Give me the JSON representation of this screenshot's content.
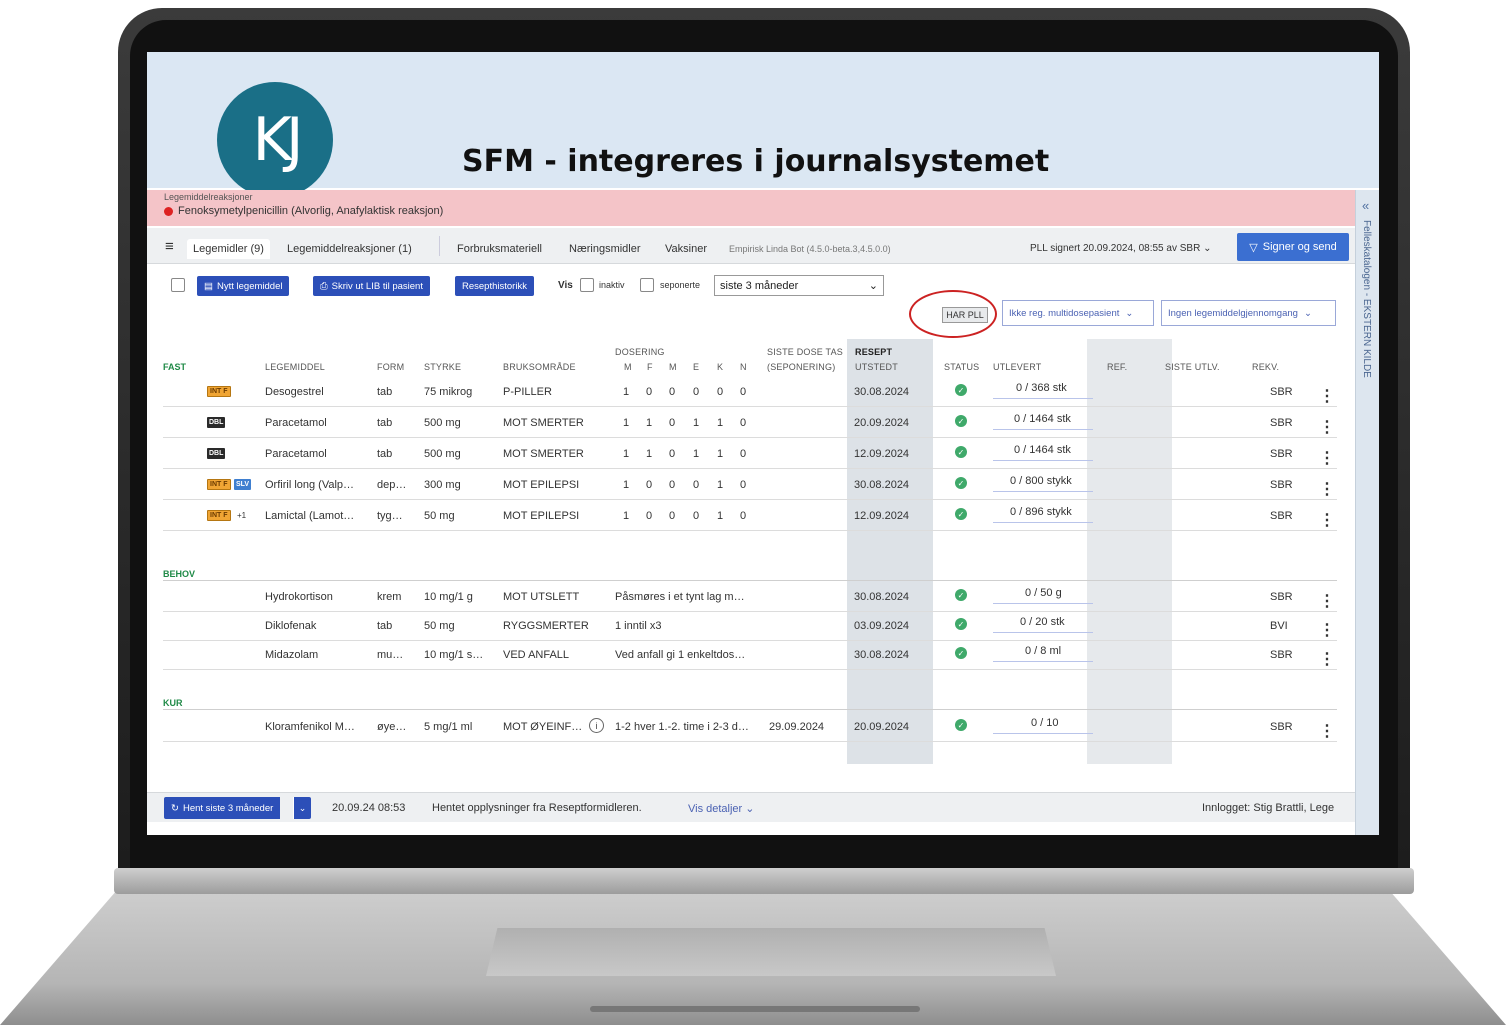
{
  "header": {
    "logo_text": "KJ",
    "title": "SFM - integreres i journalsystemet"
  },
  "allergy": {
    "label": "Legemiddelreaksjoner",
    "item": "Fenoksymetylpenicillin (Alvorlig, Anafylaktisk reaksjon)"
  },
  "side_rail": {
    "collapse": "«",
    "text": "Felleskatalogen - EKSTERN KILDE"
  },
  "tabs": {
    "menu": "≡",
    "items": [
      "Legemidler (9)",
      "Legemiddelreaksjoner (1)",
      "Forbruksmateriell",
      "Næringsmidler",
      "Vaksiner"
    ],
    "meta": "Empirisk Linda Bot (4.5.0-beta.3,4.5.0.0)",
    "pll_signed": "PLL signert 20.09.2024, 08:55 av SBR",
    "pll_chevron": "⌄",
    "sign_button": "Signer og send"
  },
  "toolbar": {
    "new_med": "Nytt legemiddel",
    "print_lib": "Skriv ut LIB til pasient",
    "history": "Resepthistorikk",
    "vis": "Vis",
    "inaktiv": "inaktiv",
    "seponerte": "seponerte",
    "period": "siste 3 måneder",
    "har_pll": "HAR PLL",
    "multidose": "Ikke reg. multidosepasient",
    "gjennomgang": "Ingen legemiddelgjennomgang"
  },
  "table": {
    "headers": {
      "legemiddel": "LEGEMIDDEL",
      "form": "FORM",
      "styrke": "STYRKE",
      "bruksomrade": "BRUKSOMRÅDE",
      "dosering": "DOSERING",
      "dos_m": "M",
      "dos_f": "F",
      "dos_m2": "M",
      "dos_e": "E",
      "dos_k": "K",
      "dos_n": "N",
      "siste_dose": "SISTE DOSE TAS",
      "seponering": "(SEPONERING)",
      "resept": "RESEPT",
      "utstedt": "UTSTEDT",
      "status": "STATUS",
      "utlevert": "UTLEVERT",
      "ref": "REF.",
      "siste_utlv": "SISTE UTLV.",
      "rekv": "REKV."
    },
    "sections": {
      "fast": "FAST",
      "behov": "BEHOV",
      "kur": "KUR"
    },
    "fast_rows": [
      {
        "badge1": "INT F",
        "name": "Desogestrel",
        "form": "tab",
        "styrke": "75 mikrog",
        "bruk": "P-PILLER",
        "d1": "1",
        "d2": "0",
        "d3": "0",
        "d4": "0",
        "d5": "0",
        "d6": "0",
        "utstedt": "30.08.2024",
        "utlevert": "0 / 368 stk",
        "rekv": "SBR"
      },
      {
        "badge1": "DBL",
        "name": "Paracetamol",
        "form": "tab",
        "styrke": "500 mg",
        "bruk": "MOT SMERTER",
        "d1": "1",
        "d2": "1",
        "d3": "0",
        "d4": "1",
        "d5": "1",
        "d6": "0",
        "utstedt": "20.09.2024",
        "utlevert": "0 / 1464 stk",
        "rekv": "SBR"
      },
      {
        "badge1": "DBL",
        "name": "Paracetamol",
        "form": "tab",
        "styrke": "500 mg",
        "bruk": "MOT SMERTER",
        "d1": "1",
        "d2": "1",
        "d3": "0",
        "d4": "1",
        "d5": "1",
        "d6": "0",
        "utstedt": "12.09.2024",
        "utlevert": "0 / 1464 stk",
        "rekv": "SBR"
      },
      {
        "badge1": "INT F",
        "badge2": "SLV",
        "name": "Orfiril long (Valp…",
        "form": "dep…",
        "styrke": "300 mg",
        "bruk": "MOT EPILEPSI",
        "d1": "1",
        "d2": "0",
        "d3": "0",
        "d4": "0",
        "d5": "1",
        "d6": "0",
        "utstedt": "30.08.2024",
        "utlevert": "0 / 800 stykk",
        "rekv": "SBR"
      },
      {
        "badge1": "INT F",
        "extra": "+1",
        "name": "Lamictal (Lamot…",
        "form": "tyg…",
        "styrke": "50 mg",
        "bruk": "MOT EPILEPSI",
        "d1": "1",
        "d2": "0",
        "d3": "0",
        "d4": "0",
        "d5": "1",
        "d6": "0",
        "utstedt": "12.09.2024",
        "utlevert": "0 / 896 stykk",
        "rekv": "SBR"
      }
    ],
    "behov_rows": [
      {
        "name": "Hydrokortison",
        "form": "krem",
        "styrke": "10 mg/1 g",
        "bruk": "MOT UTSLETT",
        "dosering": "Påsmøres i et tynt lag m…",
        "utstedt": "30.08.2024",
        "utlevert": "0 / 50 g",
        "rekv": "SBR"
      },
      {
        "name": "Diklofenak",
        "form": "tab",
        "styrke": "50 mg",
        "bruk": "RYGGSMERTER",
        "dosering": "1 inntil x3",
        "utstedt": "03.09.2024",
        "utlevert": "0 / 20 stk",
        "rekv": "BVI"
      },
      {
        "name": "Midazolam",
        "form": "mu…",
        "styrke": "10 mg/1 s…",
        "bruk": "VED ANFALL",
        "dosering": "Ved anfall gi 1 enkeltdos…",
        "utstedt": "30.08.2024",
        "utlevert": "0 / 8 ml",
        "rekv": "SBR"
      }
    ],
    "kur_rows": [
      {
        "name": "Kloramfenikol M…",
        "form": "øye…",
        "styrke": "5 mg/1 ml",
        "bruk": "MOT ØYEINF…",
        "info": "i",
        "dosering": "1-2 hver 1.-2. time i 2-3 d…",
        "siste_dose": "29.09.2024",
        "utstedt": "20.09.2024",
        "utlevert": "0 / 10",
        "rekv": "SBR"
      }
    ],
    "status_check": "✓",
    "more": "⋮"
  },
  "footer": {
    "fetch": "Hent siste 3 måneder",
    "fetch_dd": "⌄",
    "timestamp": "20.09.24 08:53",
    "message": "Hentet opplysninger fra Reseptformidleren.",
    "details": "Vis detaljer ⌄",
    "user": "Innlogget: Stig Brattli, Lege"
  },
  "colors": {
    "accent": "#2c4fb8",
    "allergy_bg": "#f4c4c8",
    "section_green": "#1f8a47",
    "header_bg": "#dbe7f3",
    "logo": "#1a6f87"
  }
}
